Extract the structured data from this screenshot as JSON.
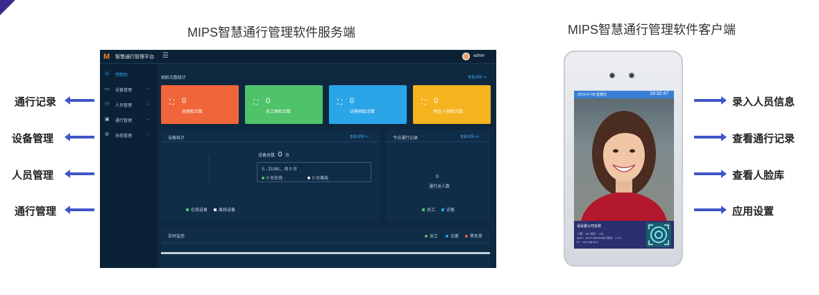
{
  "server_title": "MIPS智慧通行管理软件服务端",
  "client_title": "MIPS智慧通行管理软件客户端",
  "left_labels": [
    "通行记录",
    "设备管理",
    "人员管理",
    "通行管理"
  ],
  "right_labels": [
    "录入人员信息",
    "查看通行记录",
    "查看人脸库",
    "应用设置"
  ],
  "dashboard": {
    "app_title": "智慧通行管理平台",
    "user": "admin",
    "sidebar": [
      {
        "label": "控制台",
        "icon": "dashboard-icon"
      },
      {
        "label": "设备管理",
        "icon": "device-icon"
      },
      {
        "label": "人员管理",
        "icon": "people-icon"
      },
      {
        "label": "通行管理",
        "icon": "access-icon"
      },
      {
        "label": "系统管理",
        "icon": "settings-icon"
      }
    ],
    "face_stats": {
      "title": "刷脸次数统计",
      "more": "查看详情 >>",
      "cards": [
        {
          "value": "0",
          "label": "总刷脸次数",
          "color": "#f1653a"
        },
        {
          "value": "0",
          "label": "员工刷脸次数",
          "color": "#4fc26a"
        },
        {
          "value": "0",
          "label": "访客刷脸次数",
          "color": "#2aa6e8"
        },
        {
          "value": "0",
          "label": "陌生人刷脸次数",
          "color": "#f6b320"
        }
      ]
    },
    "device_stats": {
      "title": "设备统计",
      "more": "查看详情 >>",
      "total_label": "设备总数",
      "total_value": "0",
      "total_unit": "台",
      "device_line": "S - Z1081，共 0 台",
      "online": "0 台在线",
      "offline": "0 台离线",
      "legend_online": "在线设备",
      "legend_offline": "离线设备"
    },
    "today_records": {
      "title": "今日通行记录",
      "more": "查看详情 >>",
      "value": "0",
      "caption": "通行总人数",
      "legend_staff": "员工",
      "legend_visitor": "访客"
    },
    "monitor": {
      "title": "实时监控",
      "legend": [
        "员工",
        "访客",
        "黑名单"
      ]
    }
  },
  "phone": {
    "date": "2019-07-28 星期日",
    "time": "18:32:47",
    "company": "请设置公司名称",
    "info_lines": [
      "人数：151                 照片：120",
      "MAC：BCFC461D0805    版本：1.2.3",
      "IP：192.168.50.1"
    ]
  }
}
